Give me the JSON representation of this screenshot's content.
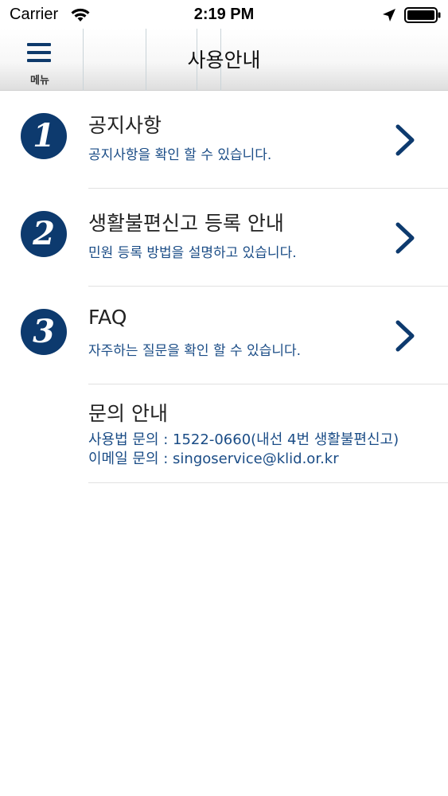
{
  "status_bar": {
    "carrier": "Carrier",
    "time": "2:19 PM",
    "icons": [
      "wifi-icon",
      "location-arrow-icon",
      "battery-icon"
    ]
  },
  "nav": {
    "menu_label": "메뉴",
    "menu_icon": "hamburger-icon",
    "title": "사용안내"
  },
  "items": [
    {
      "number": "1",
      "title": "공지사항",
      "description": "공지사항을 확인 할 수 있습니다.",
      "icon": "chevron-right-icon"
    },
    {
      "number": "2",
      "title": "생활불편신고 등록 안내",
      "description": "민원 등록 방법을 설명하고 있습니다.",
      "icon": "chevron-right-icon"
    },
    {
      "number": "3",
      "title": "FAQ",
      "description": "자주하는 질문을 확인 할 수 있습니다.",
      "icon": "chevron-right-icon"
    }
  ],
  "contact": {
    "title": "문의 안내",
    "phone_line": "사용법 문의 : 1522-0660(내선 4번 생활불편신고)",
    "email_line": "이메일 문의 : singoservice@klid.or.kr"
  },
  "colors": {
    "accent_navy": "#0d3a6e",
    "link_blue": "#1a4c86"
  }
}
